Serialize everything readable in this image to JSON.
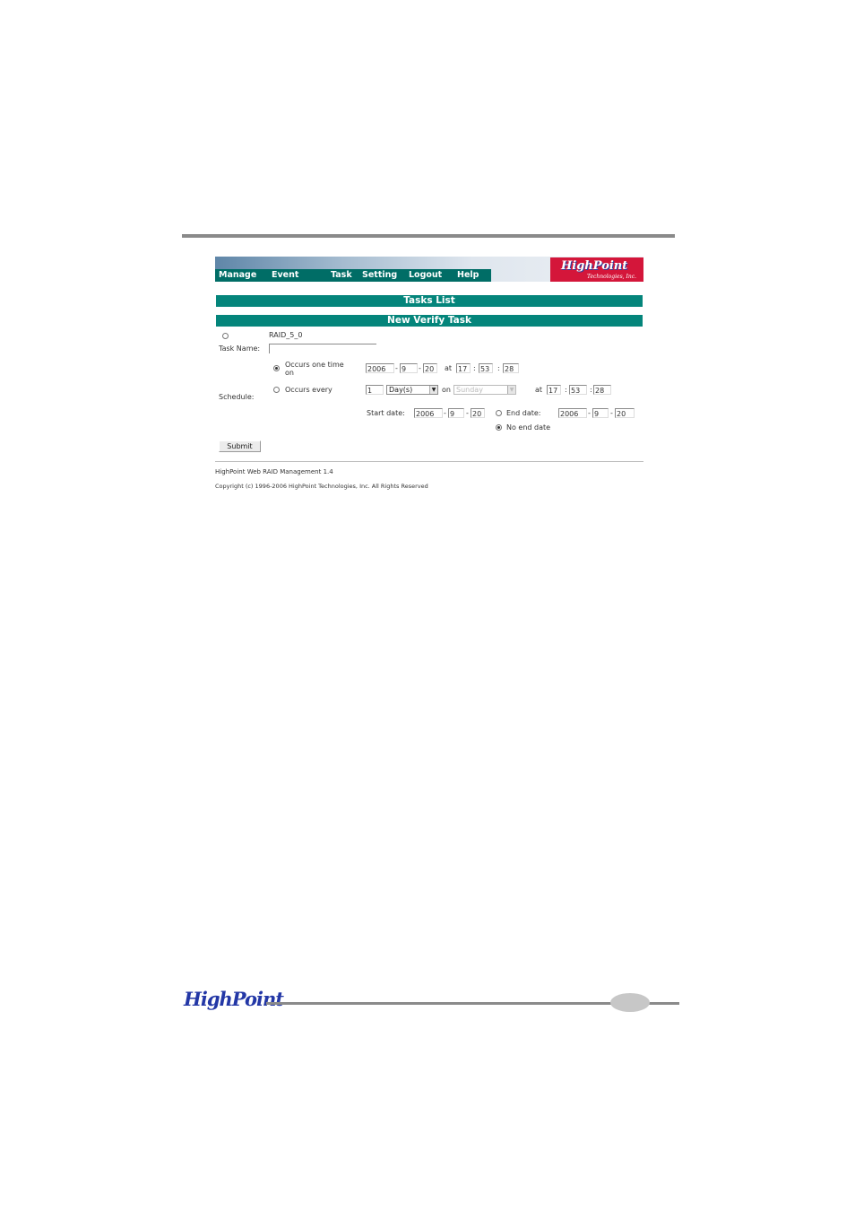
{
  "nav": {
    "items": [
      "Manage",
      "Event",
      "Task",
      "Setting",
      "Logout",
      "Help"
    ]
  },
  "logo": {
    "line1": "HighPoint",
    "line2": "Technologies, Inc."
  },
  "tasks_list_title": "Tasks List",
  "new_task_title": "New Verify Task",
  "array": {
    "label": "RAID_5_0"
  },
  "task_name": {
    "label": "Task Name:",
    "value": ""
  },
  "schedule": {
    "label": "Schedule:",
    "once": {
      "label_line1": "Occurs one time",
      "label_line2": "on",
      "year": "2006",
      "month": "9",
      "day": "20",
      "at_label": "at",
      "hour": "17",
      "minute": "53",
      "second": "28"
    },
    "every": {
      "label": "Occurs every",
      "count": "1",
      "unit": "Day(s)",
      "on_label": "on",
      "weekday": "Sunday",
      "at_label": "at",
      "hour": "17",
      "minute": "53",
      "second": "28",
      "start_label": "Start date:",
      "start_year": "2006",
      "start_month": "9",
      "start_day": "20",
      "end_label": "End date:",
      "end_year": "2006",
      "end_month": "9",
      "end_day": "20",
      "no_end_label": "No end date"
    },
    "dash": "-",
    "colon": ":"
  },
  "submit_label": "Submit",
  "footer": {
    "product": "HighPoint Web RAID Management 1.4",
    "copyright": "Copyright (c) 1996-2006 HighPoint Technologies, Inc. All Rights Reserved"
  },
  "page_footer": {
    "logo": "HighPoint"
  },
  "colors": {
    "nav_bg": "#006d66",
    "bar_bg": "#04857b",
    "logo_bg": "#d4163a",
    "brand_blue": "#2337a6"
  }
}
